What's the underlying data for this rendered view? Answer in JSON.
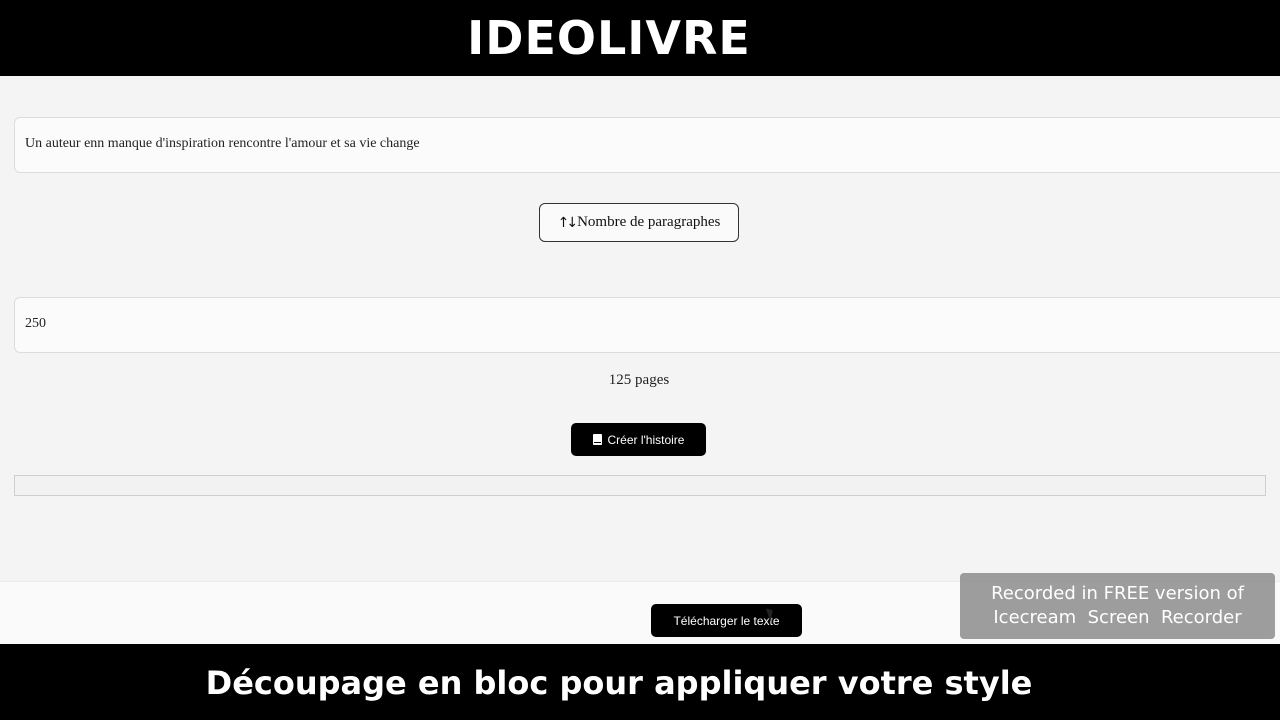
{
  "banner": {
    "title": "IDEOLIVRE"
  },
  "form": {
    "idea_value": "Un auteur enn manque d'inspiration rencontre l'amour et sa vie change",
    "paragraphs_button_label": "Nombre de paragraphes",
    "paragraphs_button_icon": "sort-arrows-icon",
    "paragraph_count_value": "250",
    "pages_label": "125 pages",
    "create_button_label": "Créer l'histoire",
    "create_button_icon": "book-icon"
  },
  "footer": {
    "download_button_label": "Télécharger le texte"
  },
  "watermark": {
    "line1": "Recorded in FREE version of",
    "line2": "Icecream  Screen  Recorder"
  },
  "caption": {
    "text": "Découpage en bloc pour appliquer votre style"
  }
}
